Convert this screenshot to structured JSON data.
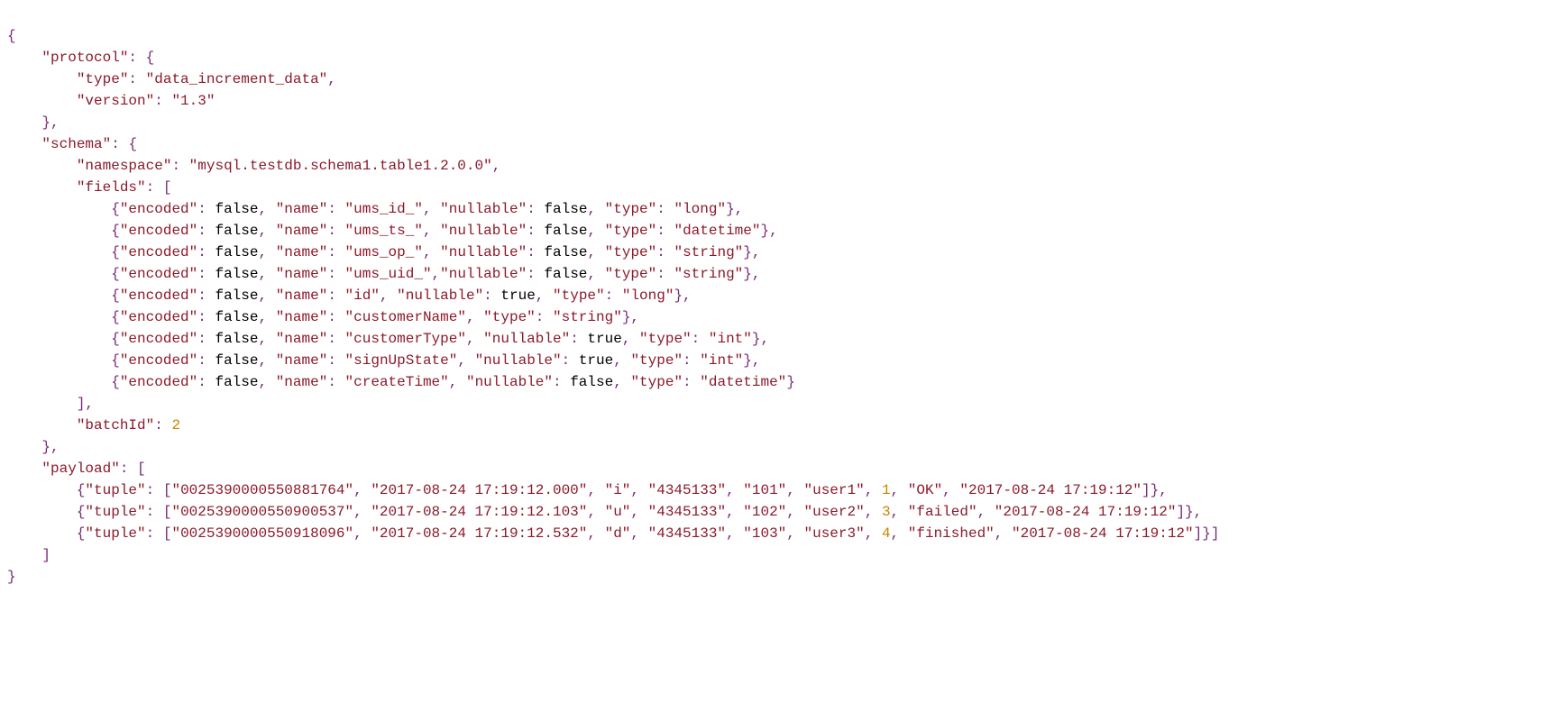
{
  "protocol": {
    "type": "data_increment_data",
    "version": "1.3"
  },
  "schema": {
    "namespace": "mysql.testdb.schema1.table1.2.0.0",
    "fields": [
      {
        "encoded": false,
        "name": "ums_id_",
        "nullable": false,
        "type": "long"
      },
      {
        "encoded": false,
        "name": "ums_ts_",
        "nullable": false,
        "type": "datetime"
      },
      {
        "encoded": false,
        "name": "ums_op_",
        "nullable": false,
        "type": "string"
      },
      {
        "encoded": false,
        "name": "ums_uid_",
        "nullable": false,
        "type": "string"
      },
      {
        "encoded": false,
        "name": "id",
        "nullable": true,
        "type": "long"
      },
      {
        "encoded": false,
        "name": "customerName",
        "type": "string"
      },
      {
        "encoded": false,
        "name": "customerType",
        "nullable": true,
        "type": "int"
      },
      {
        "encoded": false,
        "name": "signUpState",
        "nullable": true,
        "type": "int"
      },
      {
        "encoded": false,
        "name": "createTime",
        "nullable": false,
        "type": "datetime"
      }
    ],
    "batchId": 2
  },
  "payload": [
    {
      "tuple": [
        "0025390000550881764",
        "2017-08-24 17:19:12.000",
        "i",
        "4345133",
        "101",
        "user1",
        1,
        "OK",
        "2017-08-24 17:19:12"
      ]
    },
    {
      "tuple": [
        "0025390000550900537",
        "2017-08-24 17:19:12.103",
        "u",
        "4345133",
        "102",
        "user2",
        3,
        "failed",
        "2017-08-24 17:19:12"
      ]
    },
    {
      "tuple": [
        "0025390000550918096",
        "2017-08-24 17:19:12.532",
        "d",
        "4345133",
        "103",
        "user3",
        4,
        "finished",
        "2017-08-24 17:19:12"
      ]
    }
  ]
}
